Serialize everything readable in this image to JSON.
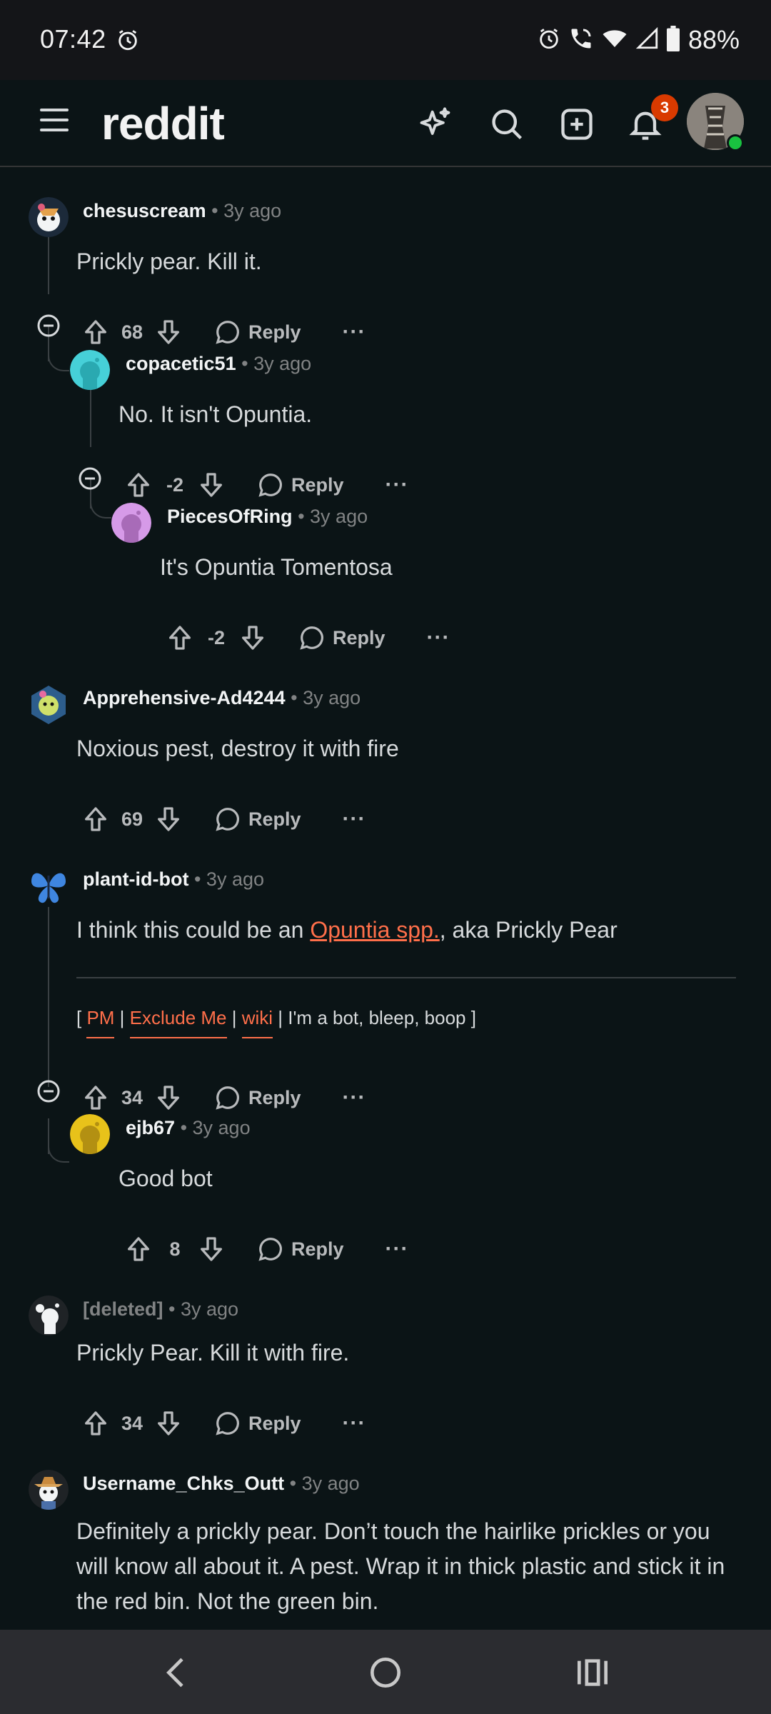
{
  "status": {
    "time": "07:42",
    "battery": "88%"
  },
  "app": {
    "logo": "reddit",
    "notifications": "3"
  },
  "comments": [
    {
      "author": "chesuscream",
      "age": "• 3y ago",
      "body": "Prickly pear. Kill it.",
      "score": "68",
      "reply": "Reply",
      "more": "···"
    },
    {
      "author": "copacetic51",
      "age": "• 3y ago",
      "body": "No. It isn't Opuntia.",
      "score": "-2",
      "reply": "Reply",
      "more": "···"
    },
    {
      "author": "PiecesOfRing",
      "age": "• 3y ago",
      "body": "It's Opuntia Tomentosa",
      "score": "-2",
      "reply": "Reply",
      "more": "···"
    },
    {
      "author": "Apprehensive-Ad4244",
      "age": "• 3y ago",
      "body": "Noxious pest, destroy it with fire",
      "score": "69",
      "reply": "Reply",
      "more": "···"
    },
    {
      "author": "plant-id-bot",
      "age": "• 3y ago",
      "body_pre": "I think this could be an ",
      "body_link": "Opuntia spp.",
      "body_post": ", aka Prickly Pear",
      "bot_open": "[ ",
      "bot_pm": "PM",
      "bot_sep1": " | ",
      "bot_exclude": "Exclude Me",
      "bot_sep2": " | ",
      "bot_wiki": "wiki",
      "bot_tail": " | I'm a bot, bleep, boop ]",
      "score": "34",
      "reply": "Reply",
      "more": "···"
    },
    {
      "author": "ejb67",
      "age": "• 3y ago",
      "body": "Good bot",
      "score": "8",
      "reply": "Reply",
      "more": "···"
    },
    {
      "author": "[deleted]",
      "age": "• 3y ago",
      "body": "Prickly Pear. Kill it with fire.",
      "score": "34",
      "reply": "Reply",
      "more": "···"
    },
    {
      "author": "Username_Chks_Outt",
      "age": "• 3y ago",
      "body": "Definitely a prickly pear. Don’t touch the hairlike prickles or you will know all about it. A pest. Wrap it in thick plastic and stick it in the red bin. Not the green bin."
    }
  ],
  "colors": {
    "background": "#0b1416",
    "accent": "#ff6f4a",
    "badge": "#d93a00",
    "online": "#19c240"
  }
}
